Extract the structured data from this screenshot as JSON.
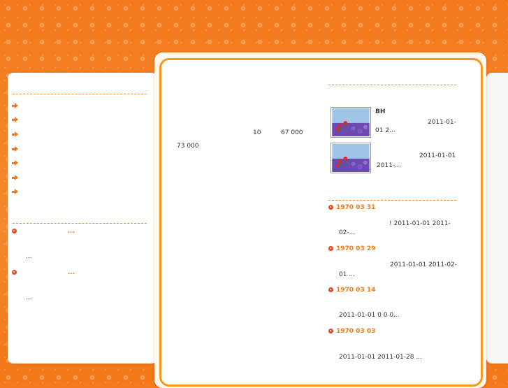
{
  "left_menu": {
    "items": [
      "",
      "",
      "",
      "",
      "",
      "",
      ""
    ]
  },
  "left_news": [
    {
      "title": "...",
      "snippet": "..."
    },
    {
      "title": "...",
      "snippet": "..."
    }
  ],
  "main": {
    "line1_a": "10",
    "line1_b": "67 000",
    "line2": "73 000"
  },
  "gallery": {
    "items": [
      {
        "title": "BH",
        "line1": "2011-01-",
        "line2": "01  2..."
      },
      {
        "title": "",
        "line1": "2011-01-01",
        "line2": "2011-..."
      }
    ]
  },
  "news": [
    {
      "date": "1970  03  31",
      "line1": "!    2011-01-01   2011-",
      "line2": "02-..."
    },
    {
      "date": "1970  03  29",
      "line1": "2011-01-01   2011-02-",
      "line2": "01    ..."
    },
    {
      "date": "1970  03  14",
      "line1": "",
      "line2": "2011-01-01      0     0   0..."
    },
    {
      "date": "1970  03  03",
      "line1": "",
      "line2": "2011-01-01   2011-01-28       ..."
    }
  ],
  "colors": {
    "accent": "#f07a1a",
    "frame": "#f39a1e",
    "bullet": "#e04a1e"
  }
}
